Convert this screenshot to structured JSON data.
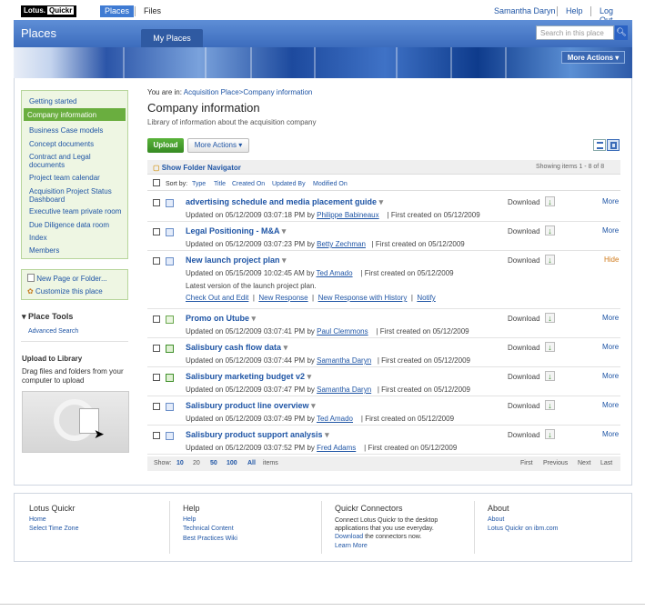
{
  "topbar": {
    "logo_a": "Lotus.",
    "logo_b": "Quickr",
    "places": "Places",
    "files": "Files",
    "user": "Samantha Daryn",
    "help": "Help",
    "logout": "Log Out"
  },
  "banner": {
    "title": "Places",
    "my_places": "My Places",
    "search_placeholder": "Search in this place",
    "more_actions": "More Actions"
  },
  "leftnav": {
    "items": [
      "Getting started",
      "Company information",
      "Business Case models",
      "Concept documents",
      "Contract and Legal documents",
      "Project team calendar",
      "Acquisition Project Status Dashboard",
      "Executive team private room",
      "Due Diligence data room",
      "Index",
      "Members"
    ],
    "new_page": "New Page or Folder...",
    "customize": "Customize this place",
    "place_tools": "Place Tools",
    "advanced_search": "Advanced Search",
    "upload_title": "Upload to Library",
    "upload_desc": "Drag files and folders from your computer to upload"
  },
  "main": {
    "you_are_in": "You are in:",
    "crumb1": "Acquisition Place",
    "crumb2": ">Company information",
    "title": "Company information",
    "subtitle": "Library of information about the acquisition company",
    "upload": "Upload",
    "more_actions": "More Actions",
    "show_folder": "Show Folder Navigator",
    "showing": "Showing items  1 - 8 of 8",
    "sort_by": "Sort by:",
    "sort": [
      "Type",
      "Title",
      "Created On",
      "Updated By",
      "Modified On"
    ],
    "download": "Download",
    "more": "More",
    "hide": "Hide",
    "desc": "Latest version of the launch project plan.",
    "actions": [
      "Check Out and Edit",
      "New Response",
      "New Response with History",
      "Notify"
    ],
    "rows": [
      {
        "title": "advertising schedule and media placement guide",
        "updated": "Updated on 05/12/2009 03:07:18 PM by",
        "by": "Philippe Babineaux",
        "created": "| First created on 05/12/2009"
      },
      {
        "title": "Legal Positioning - M&A",
        "updated": "Updated on 05/12/2009 03:07:23 PM by",
        "by": "Betty Zechman",
        "created": "| First created on 05/12/2009"
      },
      {
        "title": "New launch project plan",
        "updated": "Updated on 05/15/2009 10:02:45 AM by",
        "by": "Ted Amado",
        "created": "| First created on 05/12/2009"
      },
      {
        "title": "Promo on Utube",
        "updated": "Updated on 05/12/2009 03:07:41 PM by",
        "by": "Paul Clemmons",
        "created": "| First created on 05/12/2009"
      },
      {
        "title": "Salisbury cash flow data",
        "updated": "Updated on 05/12/2009 03:07:44 PM by",
        "by": "Samantha Daryn",
        "created": "| First created on 05/12/2009"
      },
      {
        "title": "Salisbury marketing budget v2",
        "updated": "Updated on 05/12/2009 03:07:47 PM by",
        "by": "Samantha Daryn",
        "created": "| First created on 05/12/2009"
      },
      {
        "title": "Salisbury product line overview",
        "updated": "Updated on 05/12/2009 03:07:49 PM by",
        "by": "Ted Amado",
        "created": "| First created on 05/12/2009"
      },
      {
        "title": "Salisbury product support analysis",
        "updated": "Updated on 05/12/2009 03:07:52 PM by",
        "by": "Fred Adams",
        "created": "| First created on 05/12/2009"
      }
    ],
    "show": "Show:",
    "pages": [
      "10",
      "20",
      "50",
      "100",
      "All"
    ],
    "items": "items",
    "first": "First",
    "previous": "Previous",
    "next": "Next",
    "last": "Last"
  },
  "footer": {
    "c1_title": "Lotus Quickr",
    "c1_links": [
      "Home",
      "Select Time Zone"
    ],
    "c2_title": "Help",
    "c2_links": [
      "Help",
      "Technical Content",
      "Best Practices Wiki"
    ],
    "c3_title": "Quickr Connectors",
    "c3_text": "Connect Lotus Quickr to the desktop applications that you use everyday.",
    "c3_download": "Download",
    "c3_text2": "the connectors now.",
    "c3_learn": "Learn More",
    "c4_title": "About",
    "c4_links": [
      "About",
      "Lotus Quickr on ibm.com"
    ]
  }
}
